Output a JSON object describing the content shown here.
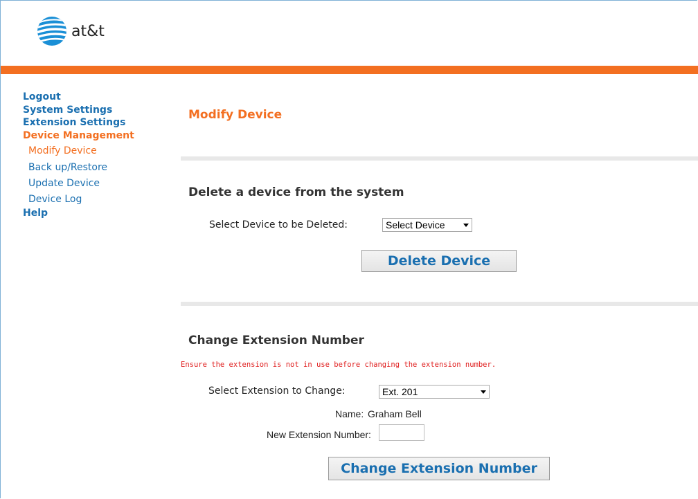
{
  "brand": {
    "name": "at&t",
    "orange": "#f36f21",
    "blue": "#1a6fb0"
  },
  "sidebar": {
    "items": [
      {
        "label": "Logout",
        "level": "top",
        "active": false
      },
      {
        "label": "System Settings",
        "level": "top",
        "active": false
      },
      {
        "label": "Extension Settings",
        "level": "top",
        "active": false
      },
      {
        "label": "Device Management",
        "level": "top",
        "active": true
      },
      {
        "label": "Modify Device",
        "level": "sub",
        "active": true
      },
      {
        "label": "Back up/Restore",
        "level": "sub",
        "active": false
      },
      {
        "label": "Update Device",
        "level": "sub",
        "active": false
      },
      {
        "label": "Device Log",
        "level": "sub",
        "active": false
      },
      {
        "label": "Help",
        "level": "top",
        "active": false
      }
    ]
  },
  "main": {
    "title": "Modify Device",
    "delete_section": {
      "heading": "Delete a device from the system",
      "select_label": "Select Device to be Deleted:",
      "select_value": "Select Device",
      "button_label": "Delete Device"
    },
    "change_section": {
      "heading": "Change Extension Number",
      "warning": "Ensure the extension is not in use before changing the extension number.",
      "select_label": "Select Extension to Change:",
      "select_value": "Ext. 201",
      "name_label": "Name:",
      "name_value": "Graham Bell",
      "new_ext_label": "New Extension Number:",
      "new_ext_value": "",
      "button_label": "Change Extension Number"
    }
  }
}
